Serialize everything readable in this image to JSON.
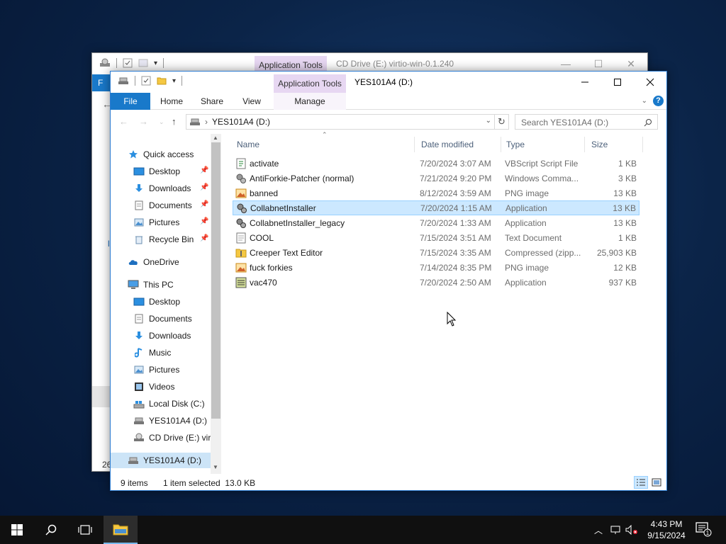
{
  "back_window": {
    "tools_label": "Application Tools",
    "title": "CD Drive (E:) virtio-win-0.1.240",
    "file_tab_partial": "F",
    "status_partial": "26"
  },
  "window": {
    "title": "YES101A4 (D:)",
    "tools_label": "Application Tools",
    "tabs": {
      "file": "File",
      "home": "Home",
      "share": "Share",
      "view": "View",
      "manage": "Manage"
    },
    "address": {
      "path": "YES101A4 (D:)"
    },
    "search": {
      "placeholder": "Search YES101A4 (D:)"
    }
  },
  "nav": {
    "quick_access": "Quick access",
    "quick_items": [
      {
        "label": "Desktop",
        "icon": "desktop-icon"
      },
      {
        "label": "Downloads",
        "icon": "downloads-icon"
      },
      {
        "label": "Documents",
        "icon": "documents-icon"
      },
      {
        "label": "Pictures",
        "icon": "pictures-icon"
      },
      {
        "label": "Recycle Bin",
        "icon": "recycle-bin-icon"
      }
    ],
    "onedrive": "OneDrive",
    "this_pc": "This PC",
    "pc_items": [
      {
        "label": "Desktop",
        "icon": "desktop-icon"
      },
      {
        "label": "Documents",
        "icon": "documents-icon"
      },
      {
        "label": "Downloads",
        "icon": "downloads-icon"
      },
      {
        "label": "Music",
        "icon": "music-icon"
      },
      {
        "label": "Pictures",
        "icon": "pictures-icon"
      },
      {
        "label": "Videos",
        "icon": "videos-icon"
      },
      {
        "label": "Local Disk (C:)",
        "icon": "local-disk-icon"
      },
      {
        "label": "YES101A4 (D:)",
        "icon": "usb-drive-icon"
      },
      {
        "label": "CD Drive (E:) virt",
        "icon": "cd-drive-icon"
      }
    ],
    "selected_drive": "YES101A4 (D:)"
  },
  "columns": {
    "name": "Name",
    "date": "Date modified",
    "type": "Type",
    "size": "Size"
  },
  "files": [
    {
      "name": "activate",
      "date": "7/20/2024 3:07 AM",
      "type": "VBScript Script File",
      "size": "1 KB",
      "icon": "script-icon"
    },
    {
      "name": "AntiForkie-Patcher (normal)",
      "date": "7/21/2024 9:20 PM",
      "type": "Windows Comma...",
      "size": "3 KB",
      "icon": "batch-file-icon"
    },
    {
      "name": "banned",
      "date": "8/12/2024 3:59 AM",
      "type": "PNG image",
      "size": "13 KB",
      "icon": "image-icon"
    },
    {
      "name": "CollabnetInstaller",
      "date": "7/20/2024 1:15 AM",
      "type": "Application",
      "size": "13 KB",
      "icon": "application-icon"
    },
    {
      "name": "CollabnetInstaller_legacy",
      "date": "7/20/2024 1:33 AM",
      "type": "Application",
      "size": "13 KB",
      "icon": "application-icon"
    },
    {
      "name": "COOL",
      "date": "7/15/2024 3:51 AM",
      "type": "Text Document",
      "size": "1 KB",
      "icon": "text-file-icon"
    },
    {
      "name": "Creeper Text Editor",
      "date": "7/15/2024 3:35 AM",
      "type": "Compressed (zipp...",
      "size": "25,903 KB",
      "icon": "zip-folder-icon"
    },
    {
      "name": "fuck forkies",
      "date": "7/14/2024 8:35 PM",
      "type": "PNG image",
      "size": "12 KB",
      "icon": "image-icon"
    },
    {
      "name": "vac470",
      "date": "7/20/2024 2:50 AM",
      "type": "Application",
      "size": "937 KB",
      "icon": "app-exe-icon"
    }
  ],
  "selected_file": "CollabnetInstaller",
  "status": {
    "item_count": "9 items",
    "selection": "1 item selected  13.0 KB"
  },
  "taskbar": {
    "time": "4:43 PM",
    "date": "9/15/2024",
    "notification_count": "1"
  },
  "colors": {
    "accent": "#1979ca",
    "selection": "#cce8ff",
    "tools_tab": "#e7d7f2",
    "desktop": "#0b2448"
  }
}
